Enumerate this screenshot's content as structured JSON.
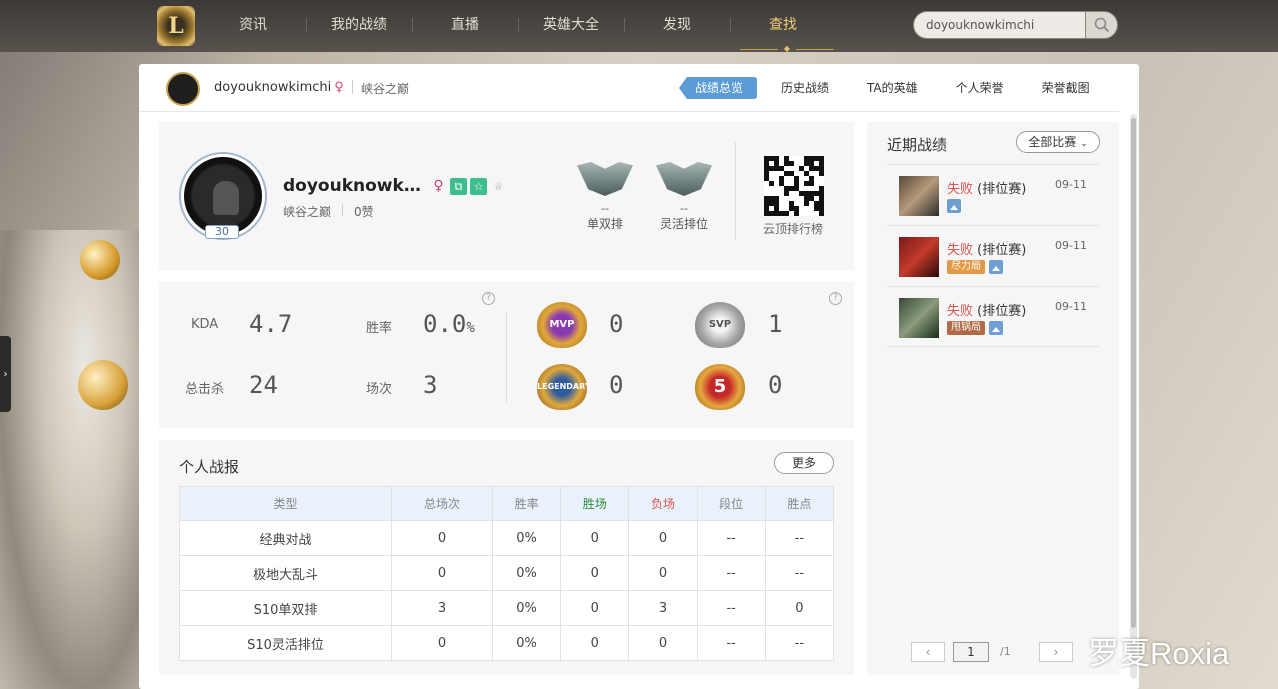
{
  "nav": {
    "items": [
      "资讯",
      "我的战绩",
      "直播",
      "英雄大全",
      "发现",
      "查找"
    ],
    "active_index": 5,
    "search_value": "doyouknowkimchi"
  },
  "subheader": {
    "username": "doyouknowkimchi",
    "gender_glyph": "♀",
    "server": "峡谷之巅",
    "tabs": [
      "战绩总览",
      "历史战绩",
      "TA的英雄",
      "个人荣誉",
      "荣誉截图"
    ],
    "active_tab": 0
  },
  "profile": {
    "name": "doyouknowki...",
    "level": "30",
    "server": "峡谷之巅",
    "likes": "0赞",
    "ranks": [
      {
        "value": "--",
        "label": "单双排"
      },
      {
        "value": "--",
        "label": "灵活排位"
      }
    ],
    "qr_label": "云顶排行榜"
  },
  "stats": {
    "kda_label": "KDA",
    "kda": "4.7",
    "winrate_label": "胜率",
    "winrate": "0.0",
    "winrate_unit": "%",
    "kills_label": "总击杀",
    "kills": "24",
    "games_label": "场次",
    "games": "3",
    "badges": [
      {
        "name": "MVP",
        "value": "0"
      },
      {
        "name": "SVP",
        "value": "1"
      },
      {
        "name": "LEGENDARY",
        "value": "0"
      },
      {
        "name": "5",
        "value": "0"
      }
    ]
  },
  "report": {
    "title": "个人战报",
    "more": "更多",
    "headers": [
      "类型",
      "总场次",
      "胜率",
      "胜场",
      "负场",
      "段位",
      "胜点"
    ],
    "rows": [
      [
        "经典对战",
        "0",
        "0%",
        "0",
        "0",
        "--",
        "--"
      ],
      [
        "极地大乱斗",
        "0",
        "0%",
        "0",
        "0",
        "--",
        "--"
      ],
      [
        "S10单双排",
        "3",
        "0%",
        "0",
        "3",
        "--",
        "0"
      ],
      [
        "S10灵活排位",
        "0",
        "0%",
        "0",
        "0",
        "--",
        "--"
      ]
    ]
  },
  "recent": {
    "title": "近期战绩",
    "filter": "全部比赛",
    "items": [
      {
        "result": "失败",
        "mode": "(排位赛)",
        "date": "09-11",
        "tag": ""
      },
      {
        "result": "失败",
        "mode": "(排位赛)",
        "date": "09-11",
        "tag": "尽力局"
      },
      {
        "result": "失败",
        "mode": "(排位赛)",
        "date": "09-11",
        "tag": "甩锅局"
      }
    ],
    "page": "1",
    "total": "/1"
  },
  "watermark": "罗夏Roxia",
  "colors": {
    "accent": "#5b9bd5",
    "loss": "#d9534f",
    "win": "#2e8b3e",
    "nav_active": "#f0cf7a"
  }
}
